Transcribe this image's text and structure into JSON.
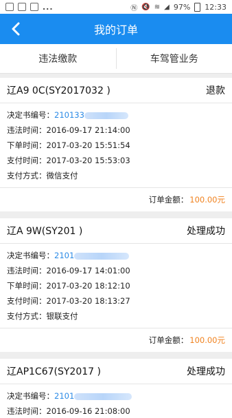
{
  "status_bar": {
    "battery": "97%",
    "time": "12:33",
    "more": "..."
  },
  "header": {
    "title": "我的订单",
    "back_icon": "chevron-left-icon"
  },
  "tabs": [
    {
      "label": "违法缴款"
    },
    {
      "label": "车驾管业务"
    }
  ],
  "orders": [
    {
      "plate": "辽A9  0C(SY2017032        )",
      "status": "退款",
      "decision_no_label": "决定书编号：",
      "decision_no": "210133",
      "violation_time": "违法时间：2016-09-17 21:14:00",
      "order_time": "下单时间：2017-03-20 15:51:54",
      "pay_time": "支付时间：2017-03-20 15:53:03",
      "pay_method": "支付方式：微信支付",
      "amount_label": "订单金额：",
      "amount": "100.00元"
    },
    {
      "plate": "辽A   9W(SY201            )",
      "status": "处理成功",
      "decision_no_label": "决定书编号：",
      "decision_no": "2101",
      "violation_time": "违法时间：2016-09-17 14:01:00",
      "order_time": "下单时间：2017-03-20 18:12:10",
      "pay_time": "支付时间：2017-03-20 18:13:27",
      "pay_method": "支付方式：银联支付",
      "amount_label": "订单金额：",
      "amount": "100.00元"
    },
    {
      "plate": "辽AP1C67(SY2017         )",
      "status": "处理成功",
      "decision_no_label": "决定书编号：",
      "decision_no": "2101",
      "violation_time": "违法时间：2016-09-16 21:08:00"
    }
  ],
  "colors": {
    "accent": "#1a8cf0",
    "link": "#2b8ae6",
    "amount": "#f0821f"
  }
}
